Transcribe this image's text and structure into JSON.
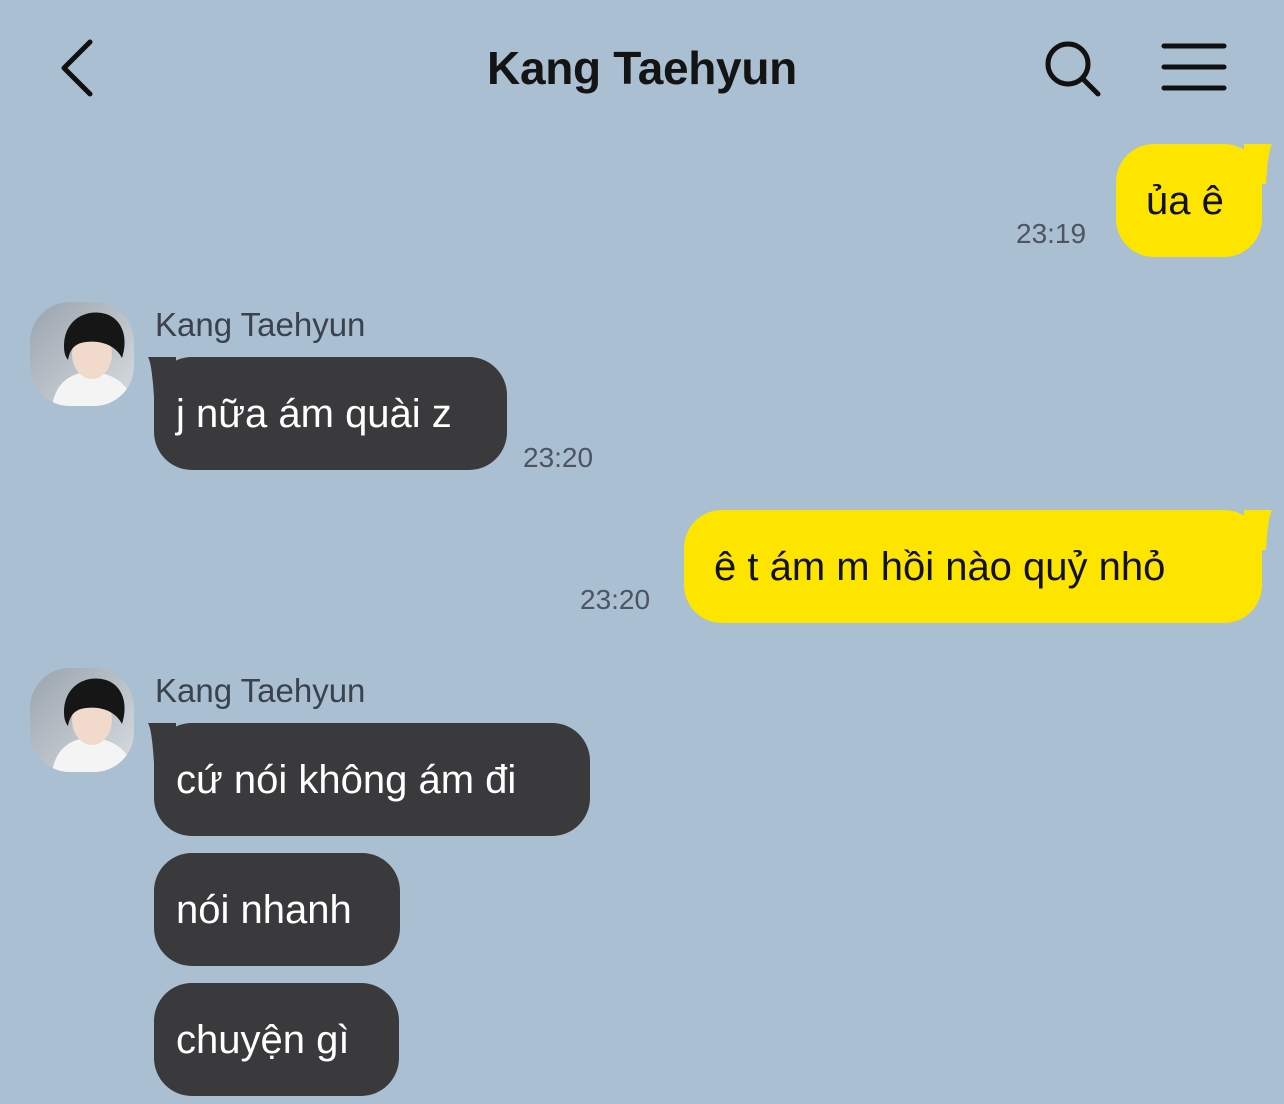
{
  "header": {
    "title": "Kang Taehyun"
  },
  "colors": {
    "background": "#aabfd2",
    "my_bubble": "#fee500",
    "their_bubble": "#3a3a3c"
  },
  "icons": {
    "back": "chevron-left-icon",
    "search": "search-icon",
    "menu": "hamburger-menu-icon"
  },
  "messages": [
    {
      "from": "me",
      "text": "ủa ê",
      "time": "23:19"
    },
    {
      "from": "them",
      "sender": "Kang Taehyun",
      "text": "j nữa ám quài z",
      "time": "23:20"
    },
    {
      "from": "me",
      "text": "ê t ám m hồi nào quỷ nhỏ",
      "time": "23:20"
    },
    {
      "from": "them",
      "sender": "Kang Taehyun",
      "text": "cứ nói không ám đi"
    },
    {
      "from": "them",
      "text": "nói nhanh"
    },
    {
      "from": "them",
      "text": "chuyện gì"
    }
  ]
}
